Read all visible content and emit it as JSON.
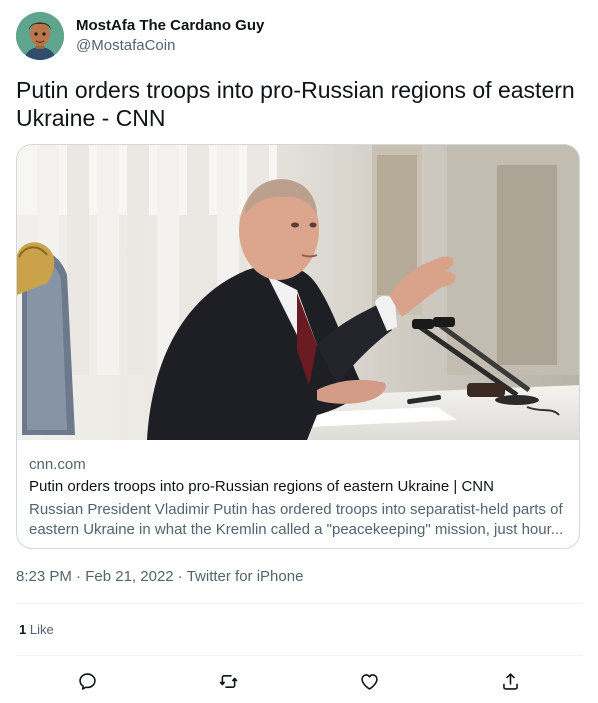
{
  "author": {
    "display_name": "MostAfa The Cardano Guy",
    "handle": "@MostafaCoin",
    "avatar_icon": "cartoon-avatar"
  },
  "tweet": {
    "text": "Putin orders troops into pro-Russian regions of eastern Ukraine - CNN"
  },
  "link_card": {
    "image_alt": "Vladimir Putin speaking at a desk with microphones",
    "domain": "cnn.com",
    "title": "Putin orders troops into pro-Russian regions of eastern Ukraine | CNN",
    "description_line1": "Russian President Vladimir Putin has ordered troops into separatist-held parts of",
    "description_line2": "eastern Ukraine in what the Kremlin called a \"peacekeeping\" mission, just hour..."
  },
  "meta": {
    "time": "8:23 PM",
    "separator1": " · ",
    "date": "Feb 21, 2022",
    "separator2": " · ",
    "source": "Twitter for iPhone"
  },
  "engagement": {
    "like_count": "1",
    "like_label": "Like"
  },
  "actions": [
    {
      "icon": "reply-icon"
    },
    {
      "icon": "retweet-icon"
    },
    {
      "icon": "like-icon"
    },
    {
      "icon": "share-icon"
    }
  ],
  "colors": {
    "text_primary": "#0f1419",
    "text_secondary": "#536471",
    "border": "#cfd9de",
    "divider": "#eff3f4"
  }
}
